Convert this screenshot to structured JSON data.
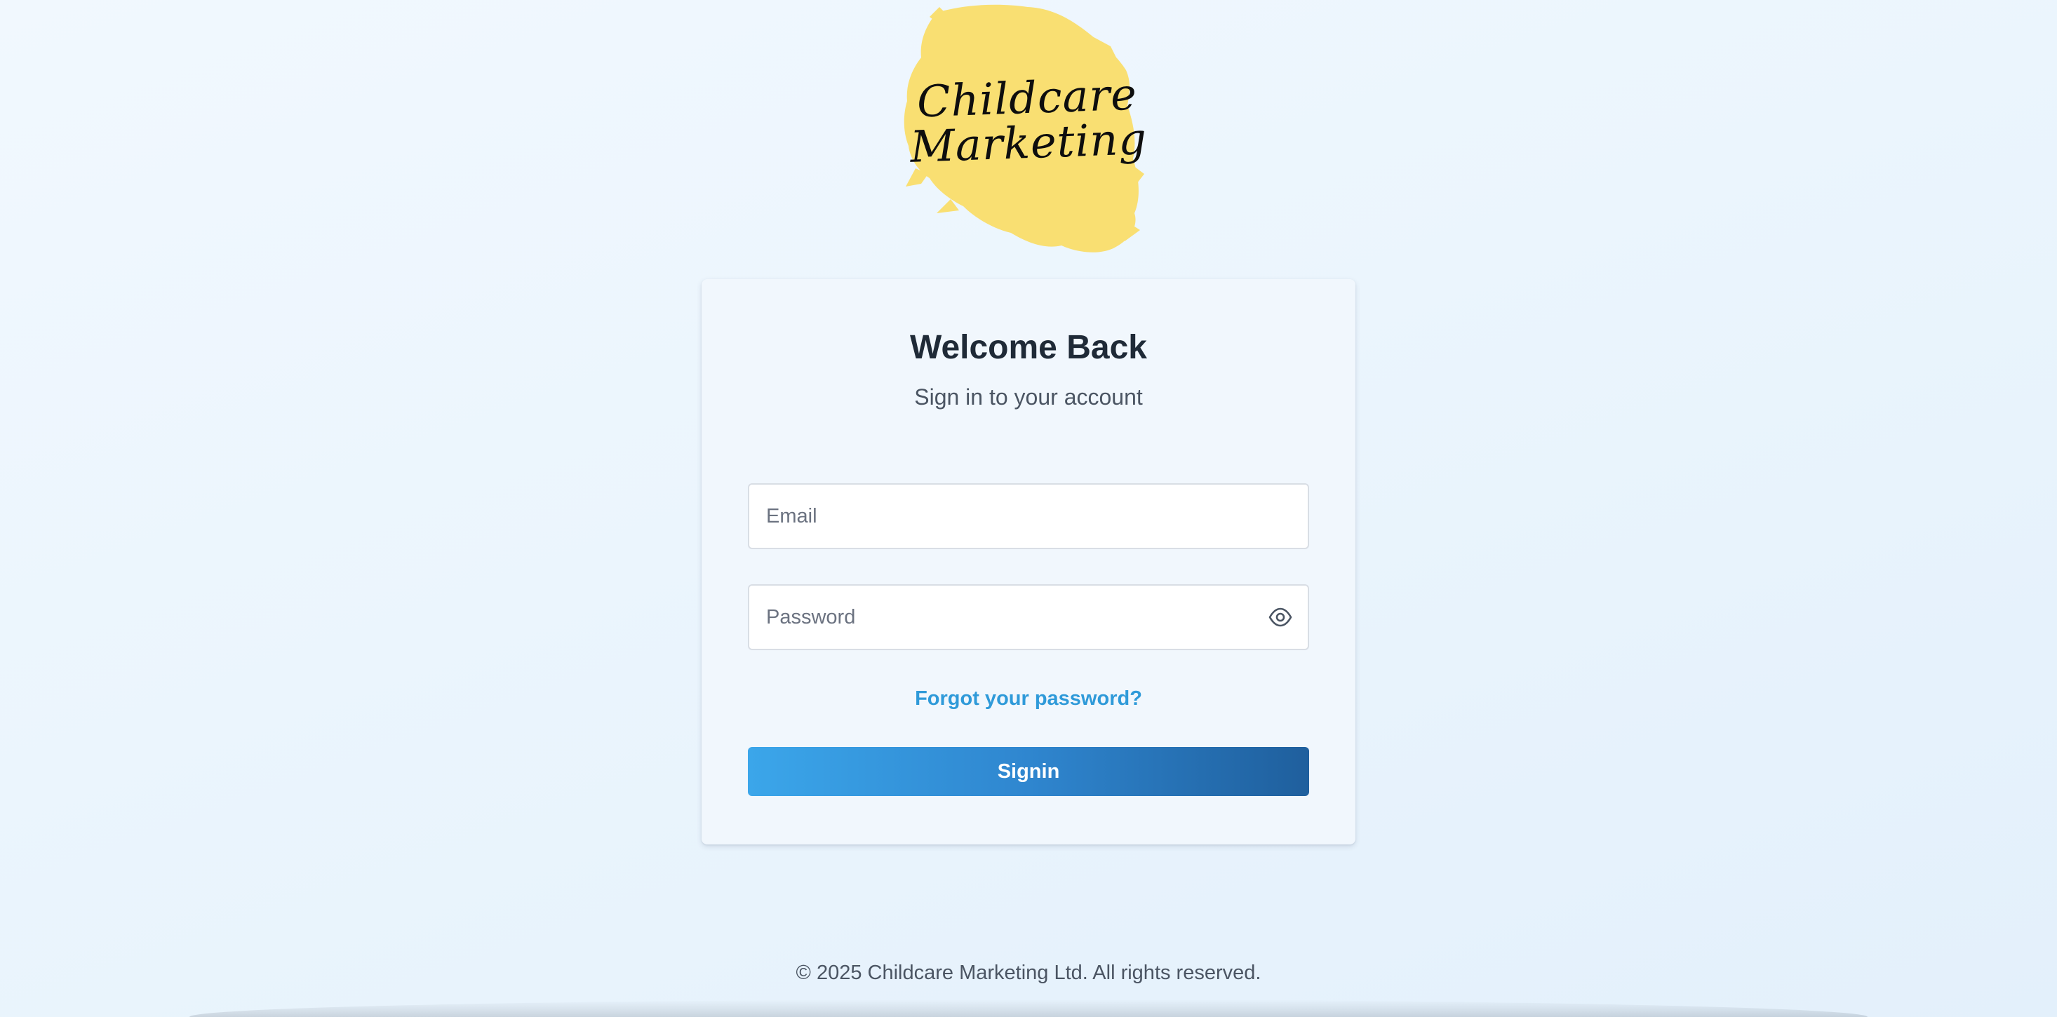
{
  "brand": {
    "logo_line1": "Childcare",
    "logo_line2": "Marketing",
    "logo_color": "#f9df72"
  },
  "login": {
    "title": "Welcome Back",
    "subtitle": "Sign in to your account",
    "email_placeholder": "Email",
    "email_value": "",
    "password_placeholder": "Password",
    "password_value": "",
    "password_toggle_icon": "eye-icon",
    "forgot_label": "Forgot your password?",
    "submit_label": "Signin"
  },
  "footer": {
    "copyright": "© 2025 Childcare Marketing Ltd. All rights reserved."
  },
  "colors": {
    "accent": "#2f9ad9",
    "button_start": "#3ba6ea",
    "button_end": "#1f5f9d",
    "heading": "#1f2a37"
  }
}
